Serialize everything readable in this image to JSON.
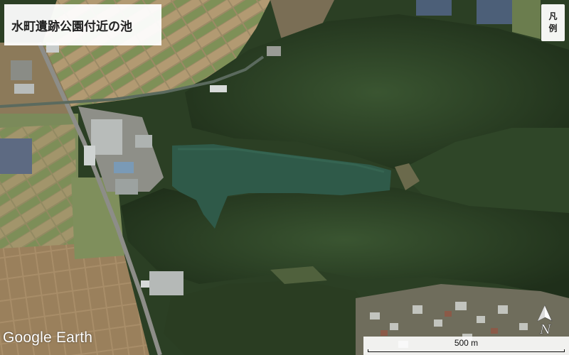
{
  "map": {
    "title": "水町遺跡公園付近の池",
    "legend": {
      "line1": "凡",
      "line2": "例"
    },
    "brand": "Google Earth",
    "scale_label": "500 m",
    "compass_letter": "N",
    "colors": {
      "water": "#2e5a4a",
      "forest_dark": "#22331c",
      "forest_mid": "#30462a",
      "field_tan": "#a48f6a",
      "field_green": "#6f8a52",
      "road": "#8c8c88",
      "roof_white": "#d9dcdc",
      "roof_blue": "#7a9ab6"
    }
  }
}
